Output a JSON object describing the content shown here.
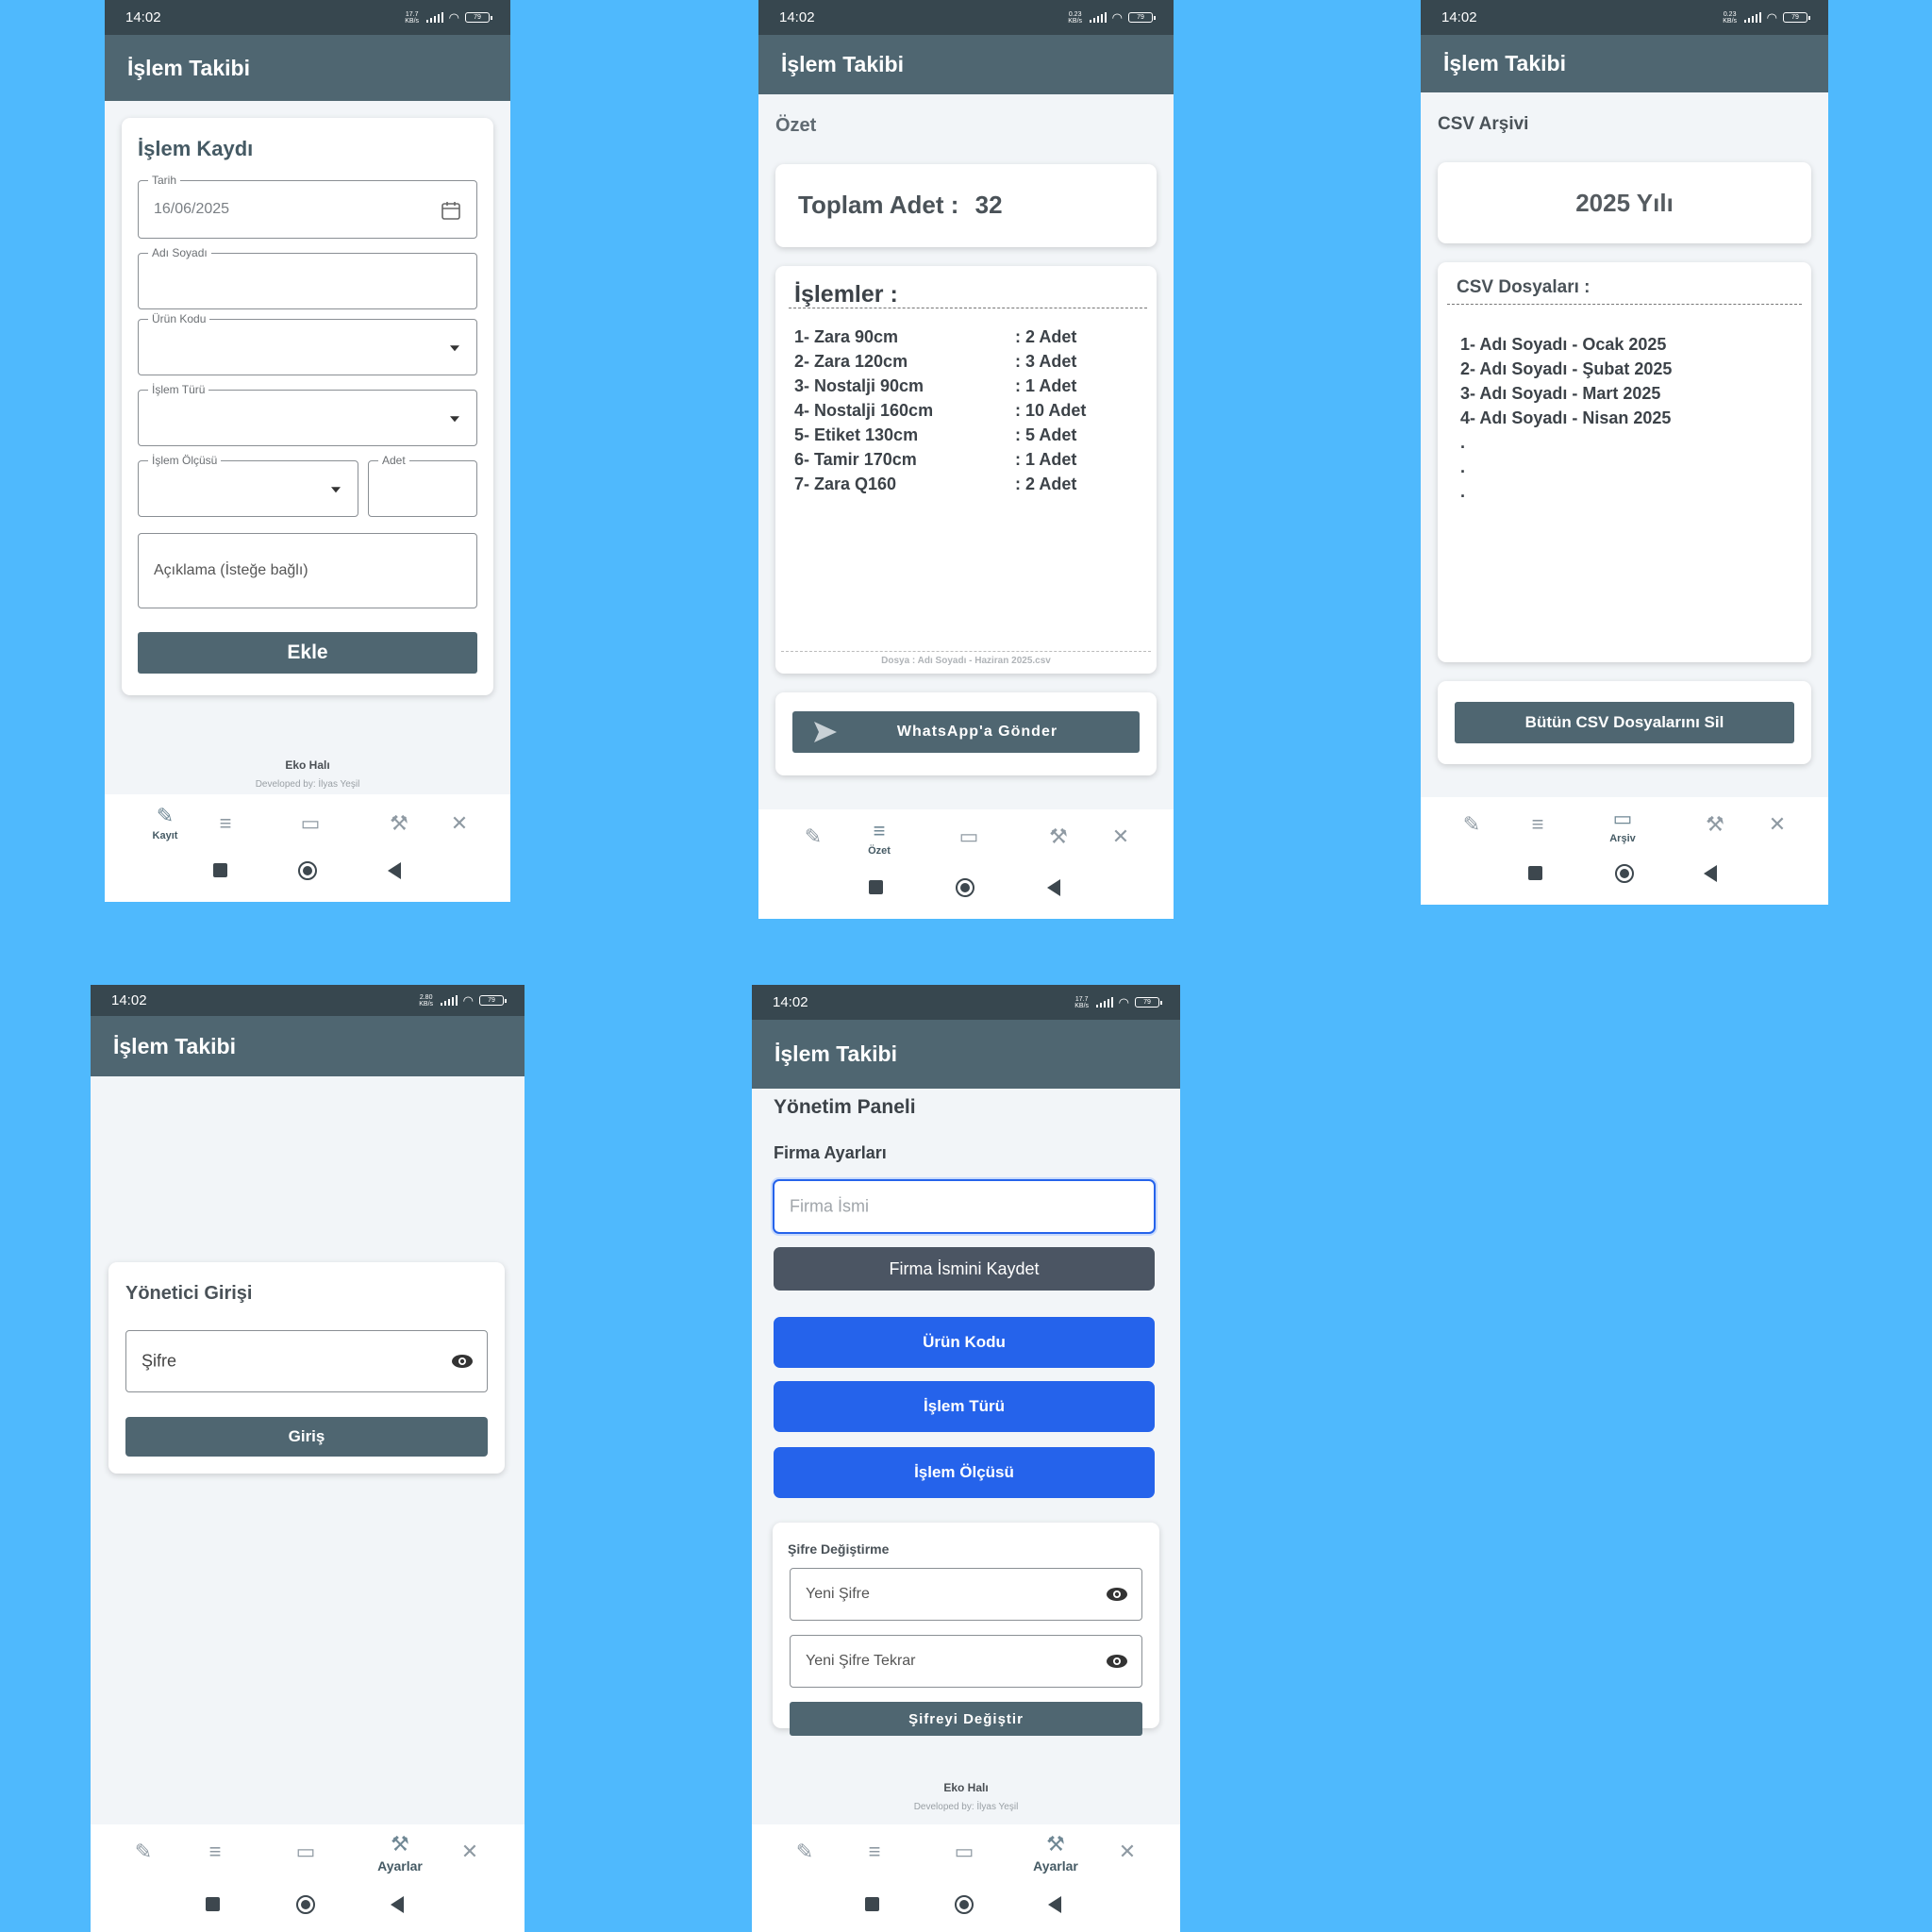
{
  "common": {
    "time": "14:02",
    "app_title": "İşlem Takibi",
    "company": "Eko Halı",
    "developer": "Developed by: İlyas Yeşil",
    "battery": "79"
  },
  "status_speeds": [
    "17.7 KB/s",
    "0.23 KB/s",
    "0.23 KB/s",
    "2.80 KB/s",
    "17.7 KB/s"
  ],
  "nav": {
    "record_label": "Kayıt",
    "summary_label": "Özet",
    "archive_label": "Arşiv",
    "settings_label": "Ayarlar"
  },
  "screen1": {
    "card_title": "İşlem Kaydı",
    "date_label": "Tarih",
    "date_value": "16/06/2025",
    "name_label": "Adı Soyadı",
    "product_label": "Ürün Kodu",
    "type_label": "İşlem Türü",
    "size_label": "İşlem Ölçüsü",
    "qty_label": "Adet",
    "note_placeholder": "Açıklama (İsteğe bağlı)",
    "add_button": "Ekle"
  },
  "screen2": {
    "heading": "Özet",
    "total_label": "Toplam Adet :",
    "total_value": "32",
    "list_title": "İşlemler :",
    "items": [
      {
        "name": "1- Zara 90cm",
        "qty": ": 2 Adet"
      },
      {
        "name": "2- Zara 120cm",
        "qty": ": 3 Adet"
      },
      {
        "name": "3- Nostalji 90cm",
        "qty": ": 1 Adet"
      },
      {
        "name": "4- Nostalji 160cm",
        "qty": ": 10 Adet"
      },
      {
        "name": "5- Etiket 130cm",
        "qty": ": 5 Adet"
      },
      {
        "name": "6- Tamir 170cm",
        "qty": ": 1 Adet"
      },
      {
        "name": "7- Zara Q160",
        "qty": ": 2 Adet"
      }
    ],
    "file_note": "Dosya : Adı Soyadı - Haziran 2025.csv",
    "whatsapp_button": "WhatsApp'a Gönder"
  },
  "screen3": {
    "heading": "CSV Arşivi",
    "year_title": "2025 Yılı",
    "files_title": "CSV Dosyaları :",
    "files": [
      "1- Adı Soyadı - Ocak 2025",
      "2- Adı Soyadı - Şubat 2025",
      "3- Adı Soyadı - Mart 2025",
      "4- Adı Soyadı - Nisan 2025",
      ".",
      ".",
      "."
    ],
    "delete_button": "Bütün CSV Dosyalarını Sil"
  },
  "screen4": {
    "card_title": "Yönetici Girişi",
    "password_placeholder": "Şifre",
    "login_button": "Giriş"
  },
  "screen5": {
    "panel_title": "Yönetim Paneli",
    "firm_settings": "Firma Ayarları",
    "firm_placeholder": "Firma İsmi",
    "save_firm_button": "Firma İsmini Kaydet",
    "product_code_button": "Ürün Kodu",
    "type_button": "İşlem Türü",
    "size_button": "İşlem Ölçüsü",
    "password_change_title": "Şifre Değiştirme",
    "new_password": "Yeni Şifre",
    "new_password_repeat": "Yeni Şifre Tekrar",
    "change_password_button": "Şifreyi Değiştir"
  },
  "colors": {
    "background": "#4fb9fd",
    "statusbar": "#37474f",
    "appbar": "#4f6671",
    "accent_blue": "#2563eb"
  }
}
